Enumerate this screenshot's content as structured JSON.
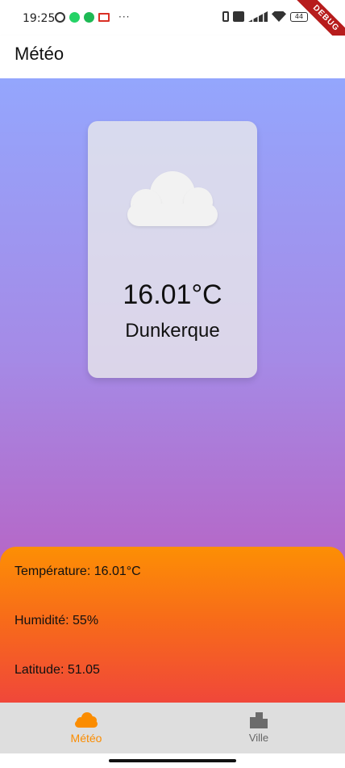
{
  "status_bar": {
    "time": "19:25",
    "left_icons": [
      "alarm-icon",
      "whatsapp-icon",
      "spotify-icon",
      "gmail-icon"
    ],
    "more": "···",
    "right_icons": [
      "bluetooth-icon",
      "volte-icon",
      "signal-icon",
      "wifi-icon",
      "battery-icon"
    ],
    "battery": "44"
  },
  "debug_banner": "DEBUG",
  "app_bar": {
    "title": "Météo"
  },
  "weather_card": {
    "icon": "cloud-icon",
    "temperature": "16.01°C",
    "city": "Dunkerque"
  },
  "details": {
    "temperature": "Température: 16.01°C",
    "humidity": "Humidité: 55%",
    "latitude": "Latitude: 51.05"
  },
  "bottom_nav": {
    "items": [
      {
        "label": "Météo",
        "icon": "cloud-icon",
        "selected": true
      },
      {
        "label": "Ville",
        "icon": "city-icon",
        "selected": false
      }
    ]
  },
  "colors": {
    "accent": "#fb8c00",
    "gradient_top": "#94a6fd",
    "gradient_bottom": "#bb5fc0",
    "panel_top": "#fd8f04",
    "panel_bottom": "#f0473a",
    "nav_background": "#dedede"
  }
}
